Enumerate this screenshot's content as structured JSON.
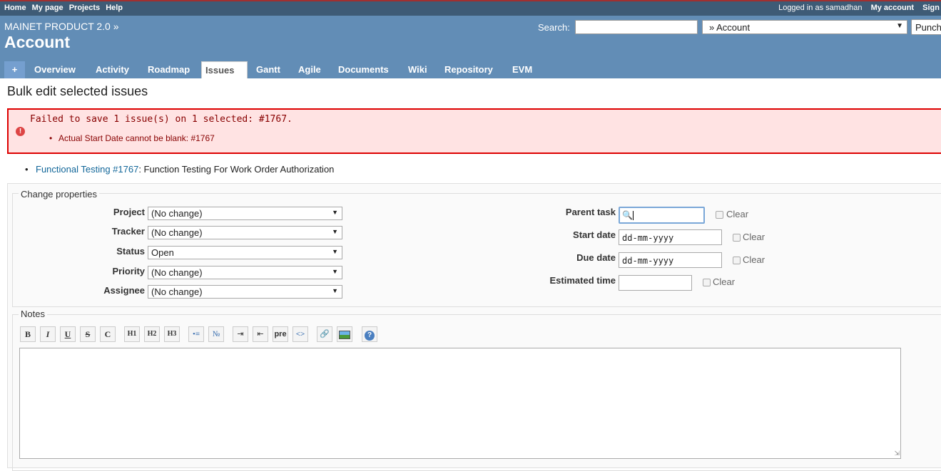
{
  "topbar": {
    "menu": [
      "Home",
      "My page",
      "Projects",
      "Help"
    ],
    "logged_in": "Logged in as samadhan",
    "my_account": "My account",
    "sign_out": "Sign"
  },
  "header": {
    "parent": "MAINET PRODUCT 2.0 »",
    "title": "Account",
    "search_label": "Search:",
    "search_value": "",
    "jump_value": "» Account",
    "punch_label": "Punch"
  },
  "tabs": [
    {
      "label": "+"
    },
    {
      "label": "Overview"
    },
    {
      "label": "Activity"
    },
    {
      "label": "Roadmap"
    },
    {
      "label": "Issues"
    },
    {
      "label": "Gantt"
    },
    {
      "label": "Agile"
    },
    {
      "label": "Documents"
    },
    {
      "label": "Wiki"
    },
    {
      "label": "Repository"
    },
    {
      "label": "EVM"
    }
  ],
  "selected_tab": "Issues",
  "page_title": "Bulk edit selected issues",
  "error": {
    "message": "Failed to save 1 issue(s) on 1 selected: #1767.",
    "item": "Actual Start Date cannot be blank: #1767"
  },
  "issue": {
    "link": "Functional Testing #1767",
    "subject": ": Function Testing For Work Order Authorization"
  },
  "change_properties": {
    "legend": "Change properties",
    "left_fields": [
      {
        "label": "Project",
        "value": "(No change)"
      },
      {
        "label": "Tracker",
        "value": "(No change)"
      },
      {
        "label": "Status",
        "value": "Open"
      },
      {
        "label": "Priority",
        "value": "(No change)"
      },
      {
        "label": "Assignee",
        "value": "(No change)"
      }
    ],
    "parent_task_label": "Parent task",
    "start_date_label": "Start date",
    "due_date_label": "Due date",
    "estimated_time_label": "Estimated time",
    "date_placeholder": "dd-mm-yyyy",
    "clear_label": "Clear"
  },
  "notes": {
    "legend": "Notes",
    "toolbar": [
      "B",
      "I",
      "U",
      "S",
      "C",
      "H1",
      "H2",
      "H3",
      "ul",
      "ol",
      "indent",
      "outdent",
      "pre",
      "code",
      "link",
      "image",
      "help"
    ],
    "value": ""
  }
}
